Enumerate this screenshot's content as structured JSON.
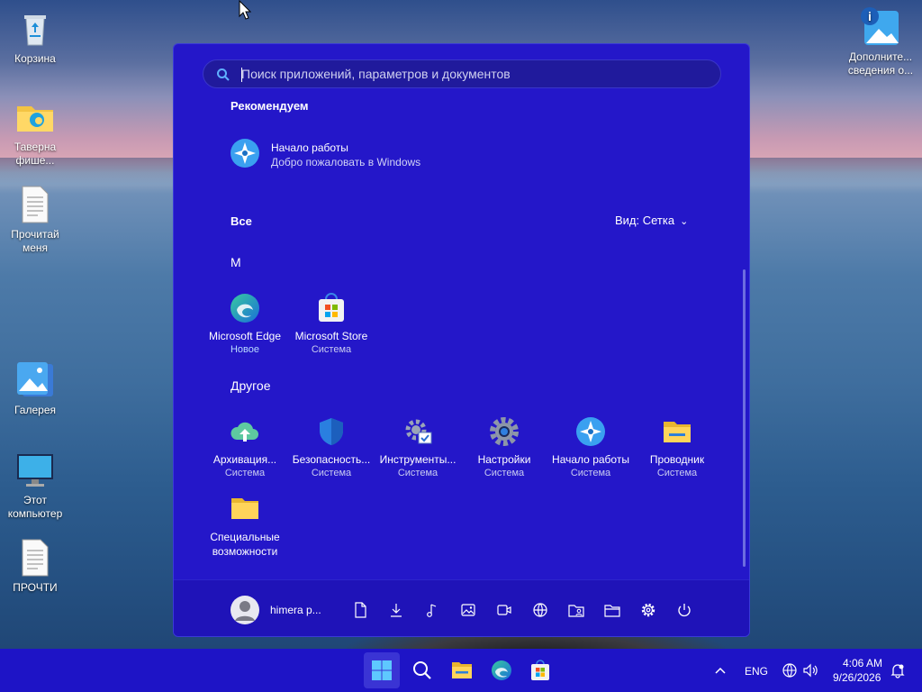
{
  "desktop": {
    "icons": [
      {
        "label": "Корзина",
        "icon": "recycle-bin-icon"
      },
      {
        "label": "Таверна фише...",
        "icon": "folder-edge-icon"
      },
      {
        "label": "Прочитай меня",
        "icon": "text-document-icon"
      },
      {
        "label": "Галерея",
        "icon": "gallery-icon"
      },
      {
        "label": "Этот компьютер",
        "icon": "monitor-icon"
      },
      {
        "label": "ПРОЧТИ",
        "icon": "text-document-icon"
      },
      {
        "label": "Дополните... сведения о...",
        "icon": "info-photo-icon"
      }
    ]
  },
  "start_menu": {
    "search": {
      "placeholder": "Поиск приложений, параметров и документов",
      "value": ""
    },
    "recommended": {
      "title": "Рекомендуем",
      "items": [
        {
          "title": "Начало работы",
          "subtitle": "Добро пожаловать в Windows",
          "icon": "get-started-icon"
        }
      ]
    },
    "all": {
      "title": "Все",
      "view_label": "Вид: Сетка",
      "groups": [
        {
          "letter": "M",
          "apps": [
            {
              "name": "Microsoft Edge",
              "sub": "Новое",
              "icon": "edge-icon"
            },
            {
              "name": "Microsoft Store",
              "sub": "Система",
              "icon": "store-icon"
            }
          ]
        },
        {
          "letter": "Другое",
          "apps": [
            {
              "name": "Архивация...",
              "sub": "Система",
              "icon": "backup-icon"
            },
            {
              "name": "Безопасность...",
              "sub": "Система",
              "icon": "security-shield-icon"
            },
            {
              "name": "Инструменты...",
              "sub": "Система",
              "icon": "tools-icon"
            },
            {
              "name": "Настройки",
              "sub": "Система",
              "icon": "settings-gear-icon"
            },
            {
              "name": "Начало работы",
              "sub": "Система",
              "icon": "get-started-icon"
            },
            {
              "name": "Проводник",
              "sub": "Система",
              "icon": "file-explorer-icon"
            },
            {
              "name": "Специальные возможности",
              "sub": "",
              "icon": "folder-icon"
            }
          ]
        }
      ]
    },
    "bottom": {
      "user_name": "himera p...",
      "icons": [
        "document-icon",
        "download-icon",
        "music-icon",
        "picture-icon",
        "video-icon",
        "network-icon",
        "user-folder-icon",
        "folder-icon",
        "settings-icon",
        "power-icon"
      ]
    }
  },
  "taskbar": {
    "pinned": [
      "start-icon",
      "search-icon",
      "file-explorer-icon",
      "edge-icon",
      "store-icon"
    ],
    "tray": {
      "chevron": "show-hidden-icons",
      "language": "ENG",
      "time": "4:06 AM",
      "date": "9/26/2026"
    }
  },
  "colors": {
    "start_bg": "#2417c9",
    "taskbar_bg": "#1e14c6",
    "accent": "#3a34d4"
  }
}
